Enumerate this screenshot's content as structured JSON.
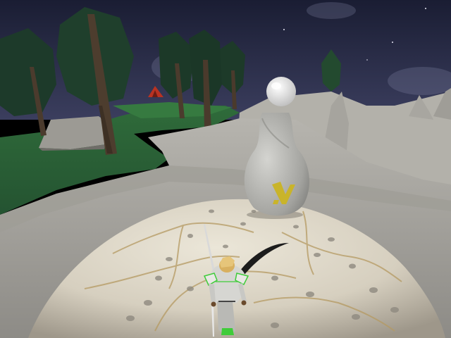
{
  "scene": {
    "colors": {
      "sky_top": "#1c2038",
      "sky_bottom": "#3a3d5c",
      "grass": "#2f6a38",
      "grass_dark": "#1f4a26",
      "rock": "#9a9a96",
      "rock_light": "#c9c7c0",
      "mound": "#d8d2c4",
      "mound_shadow": "#a8a294",
      "vein": "#b89e66",
      "totem": "#a9a9a6",
      "totem_mark": "#c9b42a",
      "orb": "#f2f2f2",
      "tree_trunk": "#4a3a2c",
      "tree_foliage": "#1d3b2a",
      "hero_armor": "#d6d6d2",
      "hero_trim": "#3fcc3a",
      "hero_hair": "#d8b060",
      "tent": "#b83222"
    },
    "icons": {
      "player": "player-character",
      "totem": "stone-totem",
      "orb": "glowing-orb",
      "camp": "tent-icon"
    }
  }
}
